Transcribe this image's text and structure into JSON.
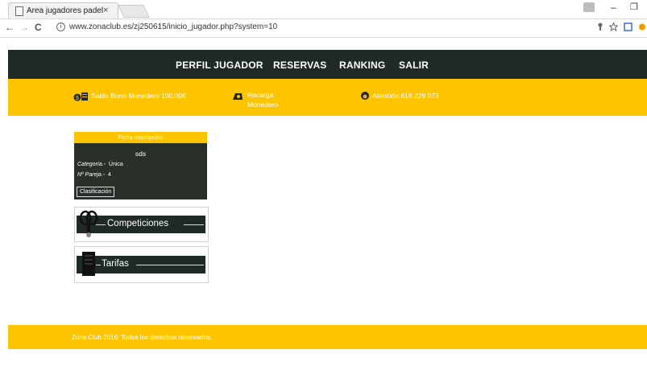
{
  "browser": {
    "tab_title": "Area jugadores padel",
    "tab_close": "×",
    "url": "www.zonaclub.es/zj250615/inicio_jugador.php?system=10",
    "nav_back": "←",
    "nav_forward": "→",
    "nav_reload": "C",
    "info_icon_glyph": "i",
    "window_min": "–",
    "window_max": "❐"
  },
  "nav": {
    "items": [
      "PERFIL JUGADOR",
      "RESERVAS",
      "RANKING",
      "SALIR"
    ]
  },
  "infobar": {
    "saldo": "Saldo Bono Monedero 100,00€",
    "recarga_line1": "Recarga",
    "recarga_line2": "Monedero",
    "atencion": "Atención 616 226 073"
  },
  "card": {
    "header": "Ficha Inscripción",
    "name": "sds",
    "categoria_label": "Categoría.-",
    "categoria_value": "Única",
    "pareja_label": "Nº Pareja.-",
    "pareja_value": "4",
    "button": "Clasificación"
  },
  "banners": {
    "competiciones": "Competiciones",
    "tarifas": "Tarifas"
  },
  "footer": {
    "text": "Zona Club 2016: Todos los derechos reservados."
  },
  "colors": {
    "accent": "#ffc400",
    "dark": "#1f2a25"
  }
}
